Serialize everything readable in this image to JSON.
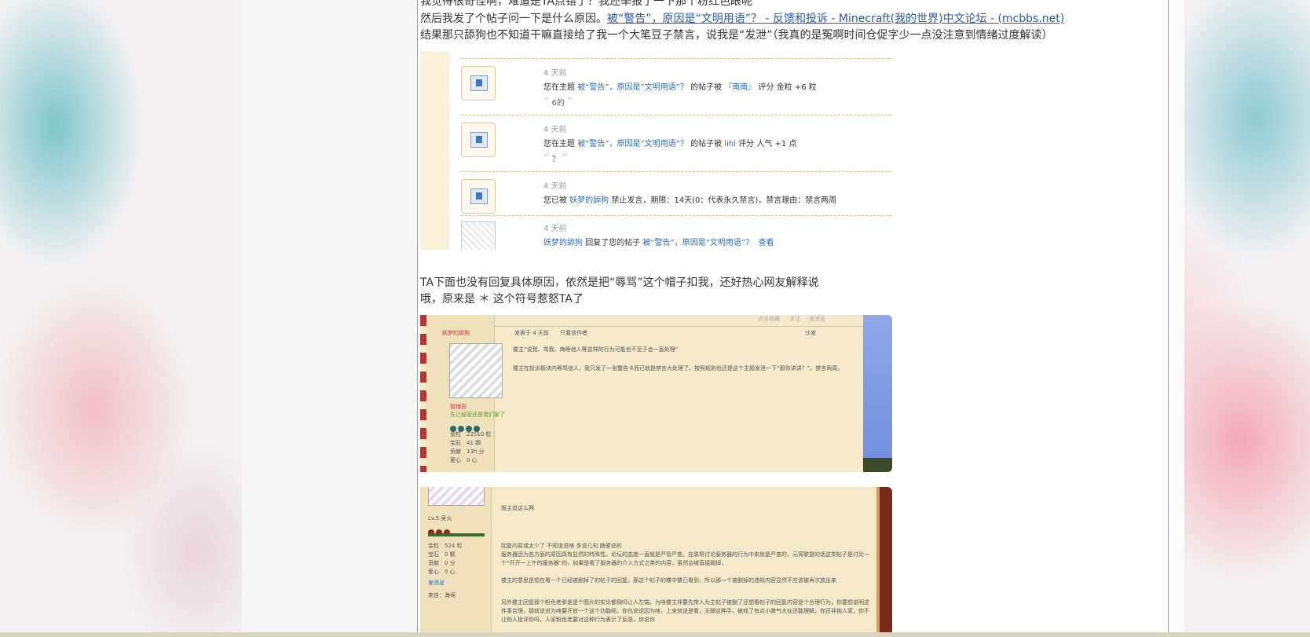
{
  "post": {
    "line_partial": "我觉得很奇怪啊，难道是TA点错了？我还举报了一下那个粉红色眼呢",
    "line1_prefix": "然后我发了个帖子问一下是什么原因。",
    "line1_link": "被“警告”，原因是“文明用语”？ - 反馈和投诉 - Minecraft(我的世界)中文论坛 - (mcbbs.net)",
    "line2": "结果那只舔狗也不知道干嘛直接给了我一个大笔豆子禁言，说我是“发泄”（我真的是冤啊时间仓促字少一点没注意到情绪过度解读）",
    "line3": "TA下面也没有回复具体原因，依然是把“辱骂”这个帽子扣我，还好热心网友解释说",
    "line4": "哦，原来是 ＊ 这个符号惹怒TA了"
  },
  "notifications": [
    {
      "time": "4 天前",
      "prefix": "您在主题",
      "topic": "被“警告”，原因是“文明用语”？",
      "mid": "的帖子被",
      "user": "『南南』",
      "suffix": "评分 金粒 +6 粒",
      "quote": "6的"
    },
    {
      "time": "4 天前",
      "prefix": "您在主题",
      "topic": "被“警告”，原因是“文明用语”？",
      "mid": "的帖子被",
      "user": "lihl",
      "suffix": "评分 人气 +1 点",
      "quote": "？"
    },
    {
      "time": "4 天前",
      "prefix": "您已被",
      "user": "妖梦的舔狗",
      "text": "禁止发言，期限：14天(0：代表永久禁言)，禁言理由：禁言两周"
    },
    {
      "time": "4 天前",
      "user": "妖梦的舔狗",
      "mid": "回复了您的帖子",
      "topic": "被“警告”，原因是“文明用语”？",
      "action": "查看"
    }
  ],
  "forum1": {
    "username": "妖梦的舔狗",
    "meta": "发表于 4 天前",
    "only_author": "只看该作者",
    "floor": "沙发",
    "reply1": "楼主“说我、骂我、侮辱他人等这样的行为可能也不至于会一直处理”",
    "reply2": "楼主在投诉板块内辱骂他人，我只发了一张警告卡而已就是禁言大处理了，按照规则也还是这个主题发泄一下“那你讲讲？”。禁言两周。",
    "rank": "管理员",
    "rank_sub": "先让秘密还是我们家了",
    "stats": [
      "金粒　22510 粒",
      "宝石　41 颗",
      "贡献　13h 分",
      "爱心　0 心"
    ],
    "topbar": [
      "点击收藏",
      "关注",
      "发消息"
    ]
  },
  "forum2": {
    "level": "Lv.5 吴火",
    "reply_head": "版主说这么两",
    "stats": [
      "金粒　524 粒",
      "宝石　0 颗",
      "贡献　0 分",
      "爱心　0 心"
    ],
    "send_msg": "发消息",
    "from": "来自：海绵",
    "p1": "回复内容或太少了 不知道说啥 多说几句 随便说的",
    "p2": "服务器因为各方面的原因具有显然的特殊性。论坛的态度一直就是严管严查。在装帮讨论服务器的行为中来就是严查的，元宵联盟的话这类帖子是讨论一个“开开一上午的服务器”的，如果是看了服务器的介入方式之类的内容，虽然会被直接踢掉，",
    "p3": "楼主的意思是想在看一个已经被删掉了的帖子的回复，那这个帖子的楼中楼已看到，所以那一个被删掉的违规内容显然不应该被再次放出来",
    "p4": "另外楼主回复那个粉色老爹是是个图片的实论都倒吗让人左端，为啥楼主非要先带入为主帖子被删了还想看帖子的回复内容是个合理行为，你要想说明这件事合理，那就说说为啥要开放一个这个功能呢。你也说说因为啥，上来就说是看，无聊这种手，被戏了有点小脾气大伙还能理解，你还非挑人家，你不让别人批评你吗，人家粉色老要对这种行为表示了反感，你说你"
  }
}
